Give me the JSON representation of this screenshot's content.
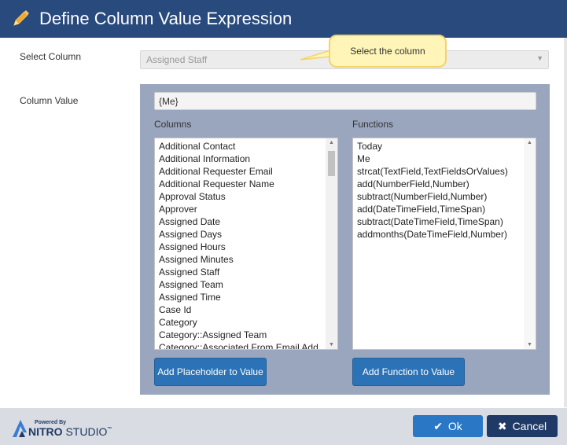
{
  "dialog": {
    "title": "Define Column Value Expression"
  },
  "select_column": {
    "label": "Select Column",
    "value": "Assigned Staff",
    "tooltip": "Select the column"
  },
  "column_value": {
    "label": "Column Value",
    "value": "{Me}"
  },
  "columns": {
    "header": "Columns",
    "items": [
      "Additional Contact",
      "Additional Information",
      "Additional Requester Email",
      "Additional Requester Name",
      "Approval Status",
      "Approver",
      "Assigned Date",
      "Assigned Days",
      "Assigned Hours",
      "Assigned Minutes",
      "Assigned Staff",
      "Assigned Team",
      "Assigned Time",
      "Case Id",
      "Category",
      "Category::Assigned Team",
      "Category::Associated From Email Add"
    ],
    "button": "Add Placeholder to Value"
  },
  "functions": {
    "header": "Functions",
    "items": [
      "Today",
      "Me",
      "strcat(TextField,TextFieldsOrValues)",
      "add(NumberField,Number)",
      "subtract(NumberField,Number)",
      "add(DateTimeField,TimeSpan)",
      "subtract(DateTimeField,TimeSpan)",
      "addmonths(DateTimeField,Number)"
    ],
    "button": "Add Function to Value"
  },
  "footer": {
    "logo_powered": "Powered By",
    "logo_brand": "NITRO STUDIO",
    "ok_label": "Ok",
    "cancel_label": "Cancel"
  },
  "colors": {
    "title_bar": "#284a7c",
    "panel": "#9aa6bd",
    "primary_button": "#2b73b6",
    "cancel_button": "#1f3a66"
  }
}
